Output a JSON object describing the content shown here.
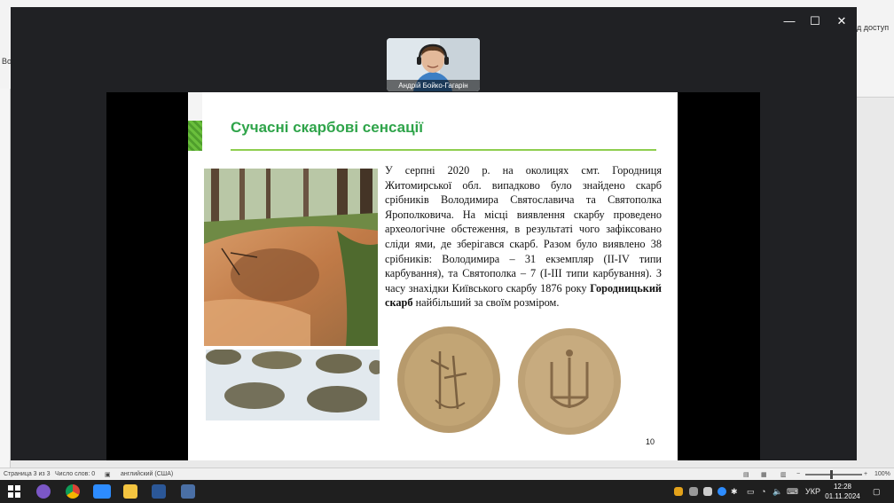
{
  "word": {
    "ribbon_left_top": "Во",
    "ribbon_right_top": "д доступ",
    "status": {
      "page": "Страница 3 из 3",
      "words": "Число слов: 0",
      "language": "английский (США)",
      "zoom": "100%"
    }
  },
  "zoom": {
    "participant_name": "Андрій Бойко-Гагарін",
    "window_controls": {
      "minimize": "—",
      "maximize": "☐",
      "close": "✕"
    }
  },
  "slide": {
    "title": "Сучасні скарбові сенсації",
    "body_part1": "У серпні 2020 р. на околицях смт. Городниця Житомирської обл. випадково було знайдено скарб срібників Володимира Святославича та Святополка Ярополковича. На місці виявлення скарбу проведено археологічне обстеження, в результаті чого зафіксовано сліди ями, де зберігався скарб. Разом було виявлено 38 срібників: Володимира – 31 екземпляр (II-IV типи карбування), та Святополка – 7 (I-III типи карбування). З часу знахідки Київського скарбу 1876 року ",
    "body_bold": "Городницький скарб",
    "body_part2": " найбільший за своїм розміром.",
    "page_number": "10"
  },
  "taskbar": {
    "language": "УКР",
    "time": "12:28",
    "date": "01.11.2024"
  },
  "colors": {
    "title_green": "#2fa44a",
    "rule_green": "#8fce4f",
    "band_green": "#6abf3c"
  }
}
